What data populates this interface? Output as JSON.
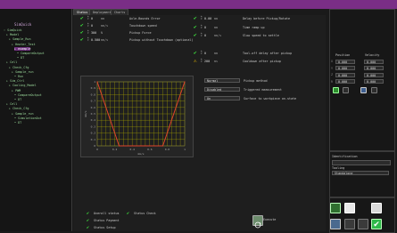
{
  "app": {
    "logo": "SimQuick"
  },
  "tree": [
    {
      "label": "› SimQuick",
      "indent": 0
    },
    {
      "label": "▸ Model",
      "indent": 1
    },
    {
      "label": "▸ Sample_Run",
      "indent": 2
    },
    {
      "label": "▸ Heater_Test",
      "indent": 3
    },
    {
      "label": "▸ example",
      "indent": 4,
      "selected": true
    },
    {
      "label": "• CompareOutput",
      "indent": 5
    },
    {
      "label": "• DT",
      "indent": 5
    },
    {
      "label": "▸ Cell",
      "indent": 1
    },
    {
      "label": "▸ Check_Cfg",
      "indent": 2
    },
    {
      "label": "▸ Sample_run",
      "indent": 3
    },
    {
      "label": "• Run",
      "indent": 4
    },
    {
      "label": "▸ Sim_Ctrl",
      "indent": 1
    },
    {
      "label": "▸ Cooling_Model",
      "indent": 2
    },
    {
      "label": "▸ PWM",
      "indent": 3
    },
    {
      "label": "• CompareOutput",
      "indent": 4
    },
    {
      "label": "• DT",
      "indent": 4
    },
    {
      "label": "▸ Cell",
      "indent": 1
    },
    {
      "label": "▸ Check_Cfg",
      "indent": 2
    },
    {
      "label": "▸ Sample_run",
      "indent": 3
    },
    {
      "label": "• SimulationOut",
      "indent": 4
    },
    {
      "label": "• DT",
      "indent": 4
    }
  ],
  "tabs": [
    {
      "label": "Status"
    },
    {
      "label": "Deployment"
    },
    {
      "label": "Charts"
    }
  ],
  "left_rows": [
    {
      "num": "0",
      "unit": "mm",
      "label": "Axle-Bounds Error"
    },
    {
      "num": "0",
      "unit": "mm/s",
      "label": "Touchdown speed"
    },
    {
      "num": "300",
      "unit": "N",
      "label": "Pickup Force"
    },
    {
      "num": "0.500",
      "unit": "mm/s",
      "label": "Pickup without Touchdown (optional)"
    }
  ],
  "right_rows": [
    {
      "num": "0.00",
      "unit": "mm",
      "label": "Delay before Pickup/Rotate"
    },
    {
      "num": "0",
      "unit": "mm",
      "label": "Time ramp up"
    },
    {
      "num": "0",
      "unit": "mm/s",
      "label": "Slow speed to settle"
    }
  ],
  "warn_rows": [
    {
      "num": "0",
      "unit": "mm",
      "label": "Tool-off delay after pickup",
      "warn": false
    },
    {
      "num": "200",
      "unit": "ms",
      "label": "Cooldown after pickup",
      "warn": true
    }
  ],
  "fields": [
    {
      "value": "Normal",
      "label": "Pickup method"
    },
    {
      "value": "Disabled",
      "label": "Triggered measurement"
    },
    {
      "value": "On",
      "label": "Surface to workpiece on-state"
    }
  ],
  "chart_data": {
    "type": "line",
    "xlabel": "mm/s",
    "ylabel": "mm/s",
    "x_ticks": [
      "0",
      "0.2",
      "0.4",
      "0.6",
      "0.8",
      "1"
    ],
    "y_ticks": [
      "1",
      "0.9",
      "0.8",
      "0.7",
      "0.6",
      "0.5",
      "0.4",
      "0.3",
      "0.2",
      "0.1",
      "0"
    ],
    "xlim": [
      0,
      1
    ],
    "ylim": [
      0,
      1
    ],
    "series": [
      {
        "x": [
          0,
          0.25,
          0.75,
          1
        ],
        "y": [
          1,
          0,
          0,
          1
        ]
      }
    ]
  },
  "status": [
    {
      "label": "Overall status",
      "checked": true
    },
    {
      "label": "Status Check",
      "checked": true
    },
    {
      "label": "Status Payment",
      "checked": true
    },
    {
      "label": "Status Setup",
      "checked": true
    }
  ],
  "execute_label": "Execute",
  "right_panel": {
    "position_header": "Position",
    "velocity_header": "Velocity",
    "positions": [
      "0.000",
      "0.000",
      "0.000",
      "0.000"
    ],
    "velocities": [
      "0.000",
      "0.000",
      "0.000",
      "0.000"
    ],
    "axis_labels": [
      "X",
      "Y",
      "Z",
      "R"
    ],
    "identification_label": "Identification",
    "tooling_label": "Tooling",
    "tooling_value": "Standalone"
  },
  "colors": {
    "brand": "#7a2e86",
    "ok": "#3ee03e",
    "warn": "#f2c200",
    "plot_line": "#e0442c"
  }
}
